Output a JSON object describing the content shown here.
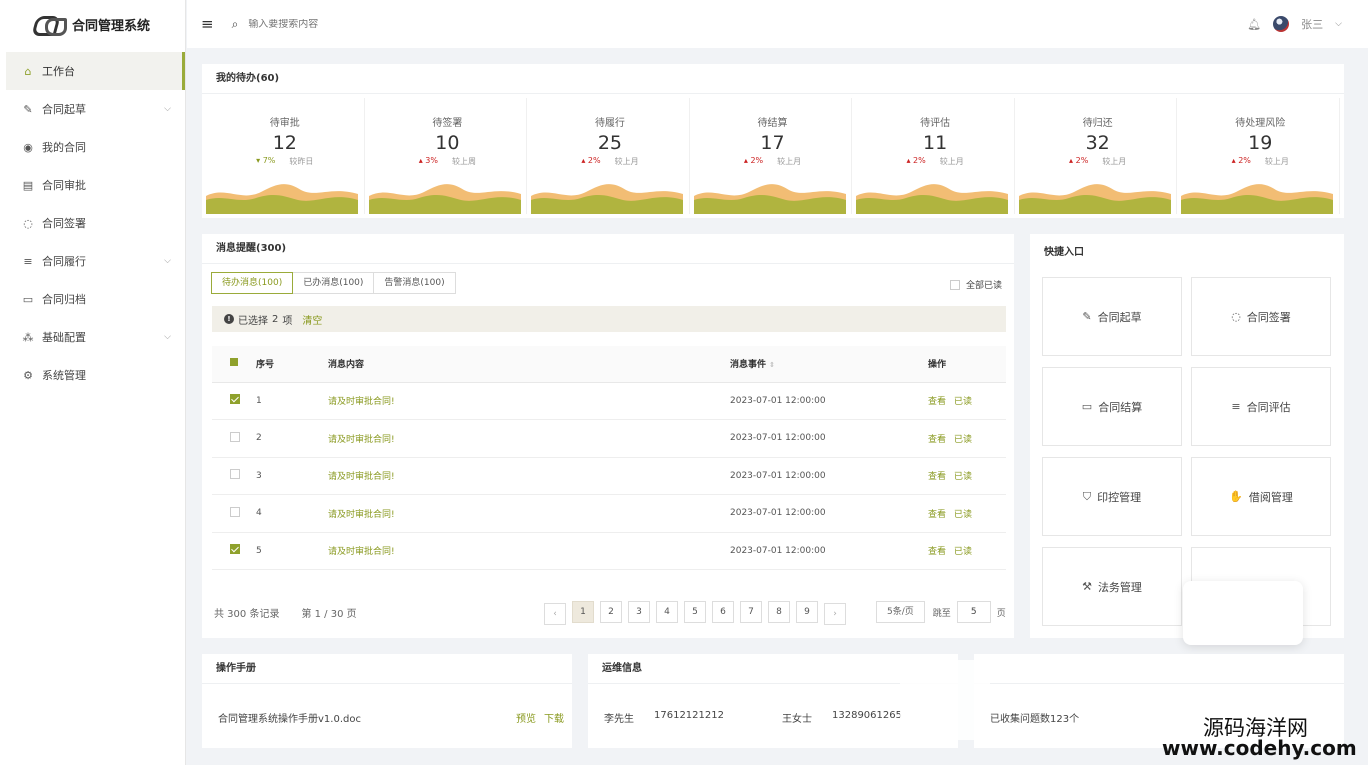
{
  "app": {
    "title": "合同管理系统"
  },
  "sidebar": {
    "items": [
      {
        "label": "工作台",
        "icon": "home-icon",
        "active": true
      },
      {
        "label": "合同起草",
        "icon": "edit-icon",
        "expand": true
      },
      {
        "label": "我的合同",
        "icon": "user-circle-icon"
      },
      {
        "label": "合同审批",
        "icon": "id-card-icon"
      },
      {
        "label": "合同签署",
        "icon": "chat-icon"
      },
      {
        "label": "合同履行",
        "icon": "list-icon",
        "expand": true
      },
      {
        "label": "合同归档",
        "icon": "laptop-icon"
      },
      {
        "label": "基础配置",
        "icon": "network-icon",
        "expand": true
      },
      {
        "label": "系统管理",
        "icon": "gear-icon"
      }
    ]
  },
  "header": {
    "search_placeholder": "输入要搜索内容",
    "user_name": "张三"
  },
  "todo": {
    "title": "我的待办(60)",
    "cards": [
      {
        "label": "待审批",
        "value": "12",
        "pct": "7%",
        "dir": "down",
        "compare": "较昨日"
      },
      {
        "label": "待签署",
        "value": "10",
        "pct": "3%",
        "dir": "up",
        "compare": "较上周"
      },
      {
        "label": "待履行",
        "value": "25",
        "pct": "2%",
        "dir": "up",
        "compare": "较上月"
      },
      {
        "label": "待结算",
        "value": "17",
        "pct": "2%",
        "dir": "up",
        "compare": "较上月"
      },
      {
        "label": "待评估",
        "value": "11",
        "pct": "2%",
        "dir": "up",
        "compare": "较上月"
      },
      {
        "label": "待归还",
        "value": "32",
        "pct": "2%",
        "dir": "up",
        "compare": "较上月"
      },
      {
        "label": "待处理风险",
        "value": "19",
        "pct": "2%",
        "dir": "up",
        "compare": "较上月"
      }
    ],
    "colors": {
      "wave_green": "#a9b23a",
      "wave_orange": "#f0b25c"
    }
  },
  "messages": {
    "title": "消息提醒(300)",
    "tabs": [
      "待办消息(100)",
      "已办消息(100)",
      "告警消息(100)"
    ],
    "read_all": "全部已读",
    "selected_text": "已选择",
    "selected_count": "2",
    "selected_unit": "项",
    "clear": "清空",
    "headers": {
      "no": "序号",
      "content": "消息内容",
      "time": "消息事件",
      "action": "操作"
    },
    "rows": [
      {
        "no": "1",
        "content": "请及时审批合同!",
        "time": "2023-07-01 12:00:00",
        "checked": true
      },
      {
        "no": "2",
        "content": "请及时审批合同!",
        "time": "2023-07-01 12:00:00",
        "checked": false
      },
      {
        "no": "3",
        "content": "请及时审批合同!",
        "time": "2023-07-01 12:00:00",
        "checked": false
      },
      {
        "no": "4",
        "content": "请及时审批合同!",
        "time": "2023-07-01 12:00:00",
        "checked": false
      },
      {
        "no": "5",
        "content": "请及时审批合同!",
        "time": "2023-07-01 12:00:00",
        "checked": true
      }
    ],
    "actions": {
      "view": "查看",
      "read": "已读"
    },
    "pager": {
      "total": "共 300 条记录",
      "page": "第 1 / 30 页",
      "pages": [
        "1",
        "2",
        "3",
        "4",
        "5",
        "6",
        "7",
        "8",
        "9"
      ],
      "page_size": "5条/页",
      "jump_label": "跳至",
      "jump_value": "5",
      "jump_unit": "页"
    }
  },
  "quick": {
    "title": "快捷入口",
    "items": [
      {
        "label": "合同起草",
        "icon": "edit-icon"
      },
      {
        "label": "合同签署",
        "icon": "chat-icon"
      },
      {
        "label": "合同结算",
        "icon": "laptop-icon"
      },
      {
        "label": "合同评估",
        "icon": "list-icon"
      },
      {
        "label": "印控管理",
        "icon": "shield-icon"
      },
      {
        "label": "借阅管理",
        "icon": "hands-icon"
      },
      {
        "label": "法务管理",
        "icon": "gavel-icon"
      },
      {
        "label": "",
        "icon": ""
      }
    ]
  },
  "manual": {
    "title": "操作手册",
    "file": "合同管理系统操作手册v1.0.doc",
    "preview": "预览",
    "download": "下载"
  },
  "ops": {
    "title": "运维信息",
    "contacts": [
      {
        "name": "李先生",
        "phone": "17612121212"
      },
      {
        "name": "王女士",
        "phone": "13289061265"
      }
    ]
  },
  "feedback": {
    "text": "已收集问题数123个"
  },
  "watermark": {
    "line1": "源码海洋网",
    "line2": "www.codehy.com"
  }
}
